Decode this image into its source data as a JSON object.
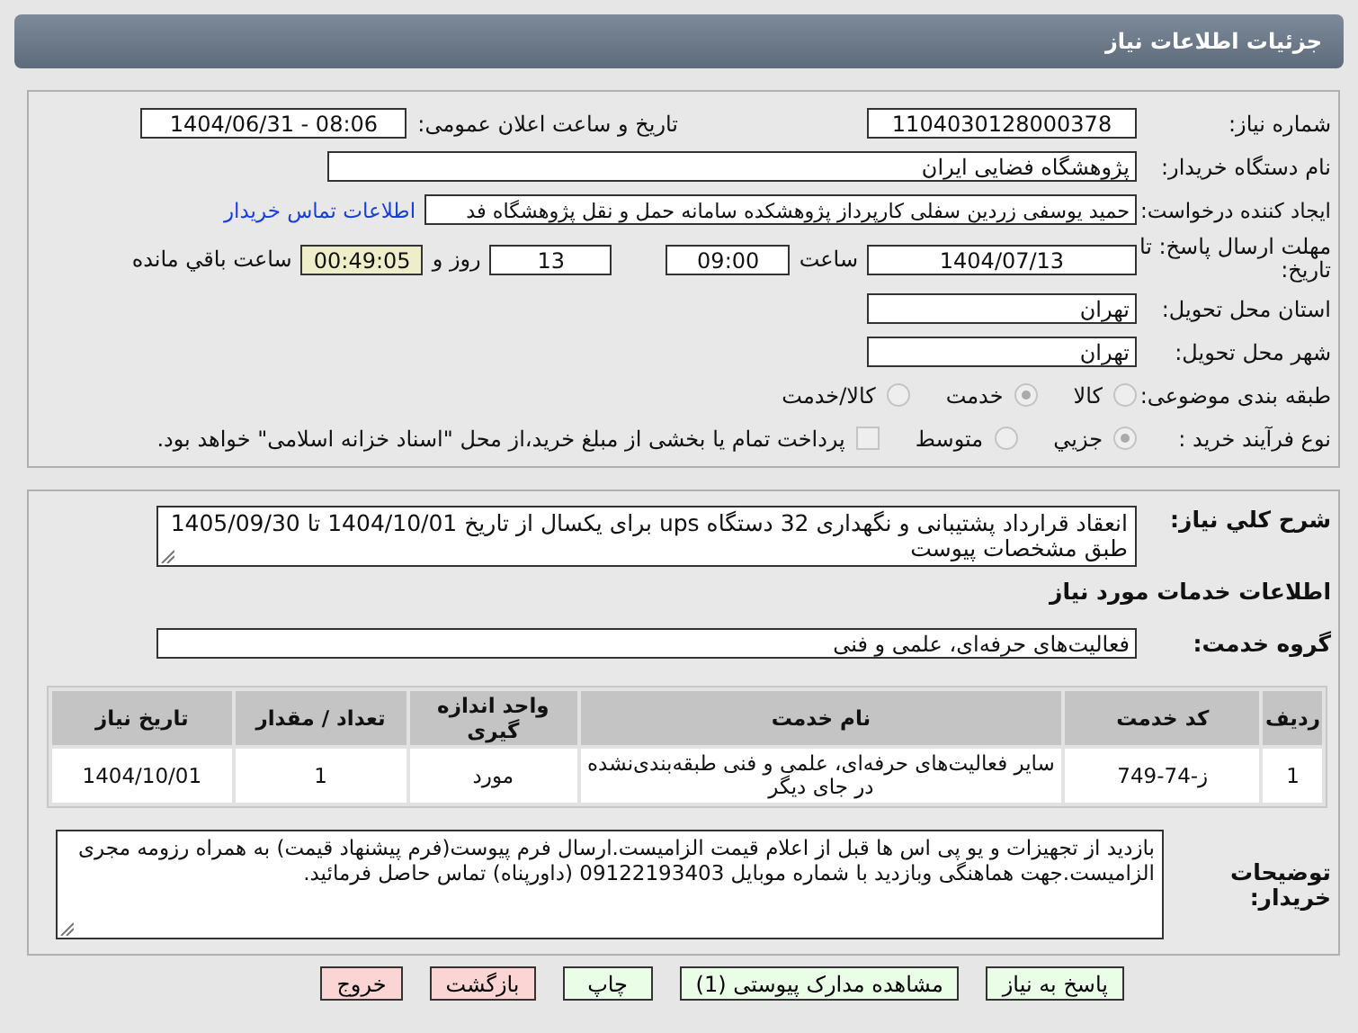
{
  "header": {
    "title": "جزئیات اطلاعات نیاز"
  },
  "need_number": {
    "label": "شماره نیاز:",
    "value": "1104030128000378"
  },
  "announce": {
    "label": "تاریخ و ساعت اعلان عمومی:",
    "value": "1404/06/31 - 08:06"
  },
  "buyer": {
    "label": "نام دستگاه خریدار:",
    "value": "پژوهشگاه فضایی ایران"
  },
  "creator": {
    "label": "ایجاد کننده درخواست:",
    "value": "حمید یوسفی زردین سفلی کارپرداز پژوهشکده سامانه حمل و نقل پژوهشگاه فد",
    "link": "اطلاعات تماس خریدار"
  },
  "deadline": {
    "label": "مهلت ارسال پاسخ: تا تاریخ:",
    "date": "1404/07/13",
    "time_label": "ساعت",
    "time": "09:00",
    "days": "13",
    "days_label": "روز و",
    "remaining": "00:49:05",
    "remaining_label": "ساعت باقي مانده"
  },
  "province": {
    "label": "استان محل تحویل:",
    "value": "تهران"
  },
  "city": {
    "label": "شهر محل تحویل:",
    "value": "تهران"
  },
  "category": {
    "label": "طبقه بندی موضوعی:",
    "options": [
      {
        "label": "کالا",
        "selected": false
      },
      {
        "label": "خدمت",
        "selected": true
      },
      {
        "label": "کالا/خدمت",
        "selected": false
      }
    ]
  },
  "process": {
    "label": "نوع فرآیند خرید :",
    "options": [
      {
        "label": "جزیي",
        "selected": true
      },
      {
        "label": "متوسط",
        "selected": false
      }
    ],
    "payment": {
      "label": "پرداخت تمام یا بخشی از مبلغ خرید،از محل \"اسناد خزانه اسلامی\" خواهد بود.",
      "checked": false
    }
  },
  "description": {
    "label": "شرح کلي نياز:",
    "value": "انعقاد قرارداد پشتیبانی و نگهداری 32 دستگاه ups برای یکسال از تاریخ 1404/10/01 تا 1405/09/30 طبق مشخصات پیوست"
  },
  "services_title": "اطلاعات خدمات مورد نیاز",
  "service_group": {
    "label": "گروه خدمت:",
    "value": "فعالیت‌های حرفه‌ای، علمی و فنی"
  },
  "table": {
    "columns": [
      "ردیف",
      "کد خدمت",
      "نام خدمت",
      "واحد اندازه گیری",
      "تعداد / مقدار",
      "تاریخ نیاز"
    ],
    "rows": [
      [
        "1",
        "ز-74-749",
        "سایر فعالیت‌های حرفه‌ای، علمی و فنی طبقه‌بندی‌نشده در جای دیگر",
        "مورد",
        "1",
        "1404/10/01"
      ]
    ]
  },
  "notes": {
    "label": "توضیحات خریدار:",
    "value": "بازدید از تجهیزات و یو پی اس ها قبل از اعلام قیمت الزامیست.ارسال فرم پیوست(فرم پیشنهاد قیمت) به همراه رزومه مجری الزامیست.جهت هماهنگی وبازدید با شماره موبایل 09122193403 (داورپناه)  تماس حاصل فرمائید."
  },
  "buttons": [
    {
      "label": "پاسخ به نیاز",
      "kind": "normal"
    },
    {
      "label": "مشاهده مدارک پیوستی (1)",
      "kind": "normal"
    },
    {
      "label": "چاپ",
      "kind": "normal"
    },
    {
      "label": "بازگشت",
      "kind": "danger"
    },
    {
      "label": "خروج",
      "kind": "danger"
    }
  ]
}
